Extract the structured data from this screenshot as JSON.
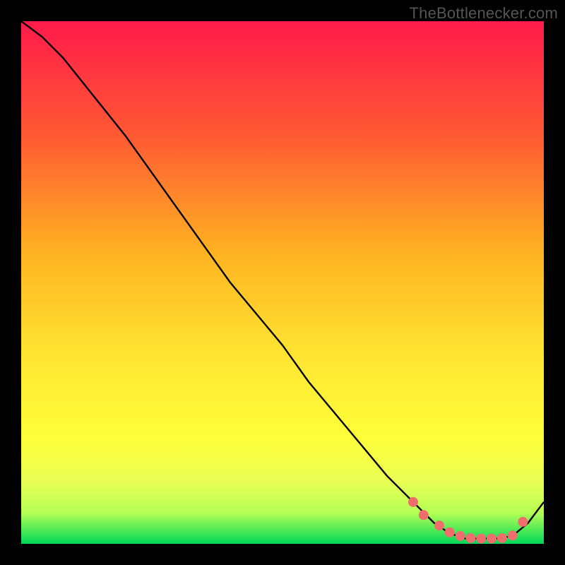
{
  "watermark": "TheBottlenecker.com",
  "chart_data": {
    "type": "line",
    "title": "",
    "xlabel": "",
    "ylabel": "",
    "xlim": [
      0,
      100
    ],
    "ylim": [
      0,
      100
    ],
    "background_gradient": {
      "from": "#ff1a4a",
      "via": [
        "#ff6a33",
        "#ffc322",
        "#ffff33",
        "#e8ff55"
      ],
      "to": "#00e05a"
    },
    "series": [
      {
        "name": "curve",
        "x": [
          0,
          4,
          8,
          12,
          16,
          20,
          25,
          30,
          35,
          40,
          45,
          50,
          55,
          60,
          65,
          70,
          75,
          79,
          82,
          85,
          88,
          91,
          94,
          97,
          100
        ],
        "y": [
          100,
          97,
          93,
          88,
          83,
          78,
          71,
          64,
          57,
          50,
          44,
          38,
          31,
          25,
          19,
          13,
          8,
          4,
          2,
          1,
          1,
          1,
          1.5,
          4,
          8
        ]
      }
    ],
    "markers": {
      "name": "optimal-zone",
      "color": "#ef6d6d",
      "x": [
        75,
        77,
        80,
        82,
        84,
        86,
        88,
        90,
        92,
        94,
        96
      ],
      "y": [
        8,
        5.5,
        3.5,
        2.2,
        1.5,
        1.1,
        1.0,
        1.0,
        1.1,
        1.6,
        4.2
      ]
    }
  }
}
